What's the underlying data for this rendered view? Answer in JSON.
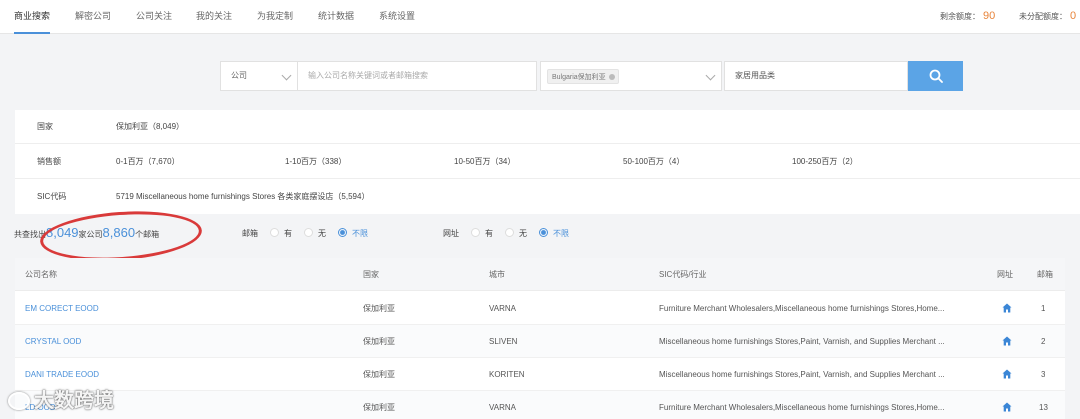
{
  "nav": {
    "items": [
      "商业搜索",
      "解密公司",
      "公司关注",
      "我的关注",
      "为我定制",
      "统计数据",
      "系统设置"
    ],
    "remaining_label": "剩余额度：",
    "remaining_value": "90",
    "unassigned_label": "未分配额度：",
    "unassigned_value": "0"
  },
  "search": {
    "type_select": "公司",
    "placeholder": "输入公司名称关键词或者邮箱搜索",
    "country_tag": "Bulgaria保加利亚",
    "industry": "家居用品类"
  },
  "filters": {
    "country_label": "国家",
    "country_value": "保加利亚（8,049）",
    "sales_label": "销售额",
    "sales_options": [
      "0-1百万（7,670）",
      "1-10百万（338）",
      "10-50百万（34）",
      "50-100百万（4）",
      "100-250百万（2）"
    ],
    "sic_label": "SIC代码",
    "sic_value": "5719 Miscellaneous home furnishings Stores 各类家庭摆设店（5,594）"
  },
  "results": {
    "prefix": "共查找出",
    "companies": "8,049",
    "mid": "家公司",
    "emails": "8,860",
    "suffix": "个邮箱"
  },
  "email_filter": {
    "label": "邮箱",
    "options": [
      "有",
      "无",
      "不限"
    ],
    "selected": "不限"
  },
  "website_filter": {
    "label": "网址",
    "options": [
      "有",
      "无",
      "不限"
    ],
    "selected": "不限"
  },
  "table": {
    "headers": [
      "公司名称",
      "国家",
      "城市",
      "SIC代码/行业",
      "网址",
      "邮箱"
    ],
    "rows": [
      {
        "name": "EM CORECT EOOD",
        "country": "保加利亚",
        "city": "VARNA",
        "sic": "Furniture Merchant Wholesalers,Miscellaneous home furnishings Stores,Home...",
        "emails": "1"
      },
      {
        "name": "CRYSTAL OOD",
        "country": "保加利亚",
        "city": "SLIVEN",
        "sic": "Miscellaneous home furnishings Stores,Paint, Varnish, and Supplies Merchant ...",
        "emails": "2"
      },
      {
        "name": "DANI TRADE EOOD",
        "country": "保加利亚",
        "city": "KORITEN",
        "sic": "Miscellaneous home furnishings Stores,Paint, Varnish, and Supplies Merchant ...",
        "emails": "3"
      },
      {
        "name": "LD OOD",
        "country": "保加利亚",
        "city": "VARNA",
        "sic": "Furniture Merchant Wholesalers,Miscellaneous home furnishings Stores,Home...",
        "emails": "13"
      }
    ]
  },
  "watermark": "大数跨境",
  "colors": {
    "accent": "#4a90d9",
    "search_button": "#5ba4e6",
    "quota_number": "#e8843a",
    "annotation_oval": "#d93a3a"
  }
}
